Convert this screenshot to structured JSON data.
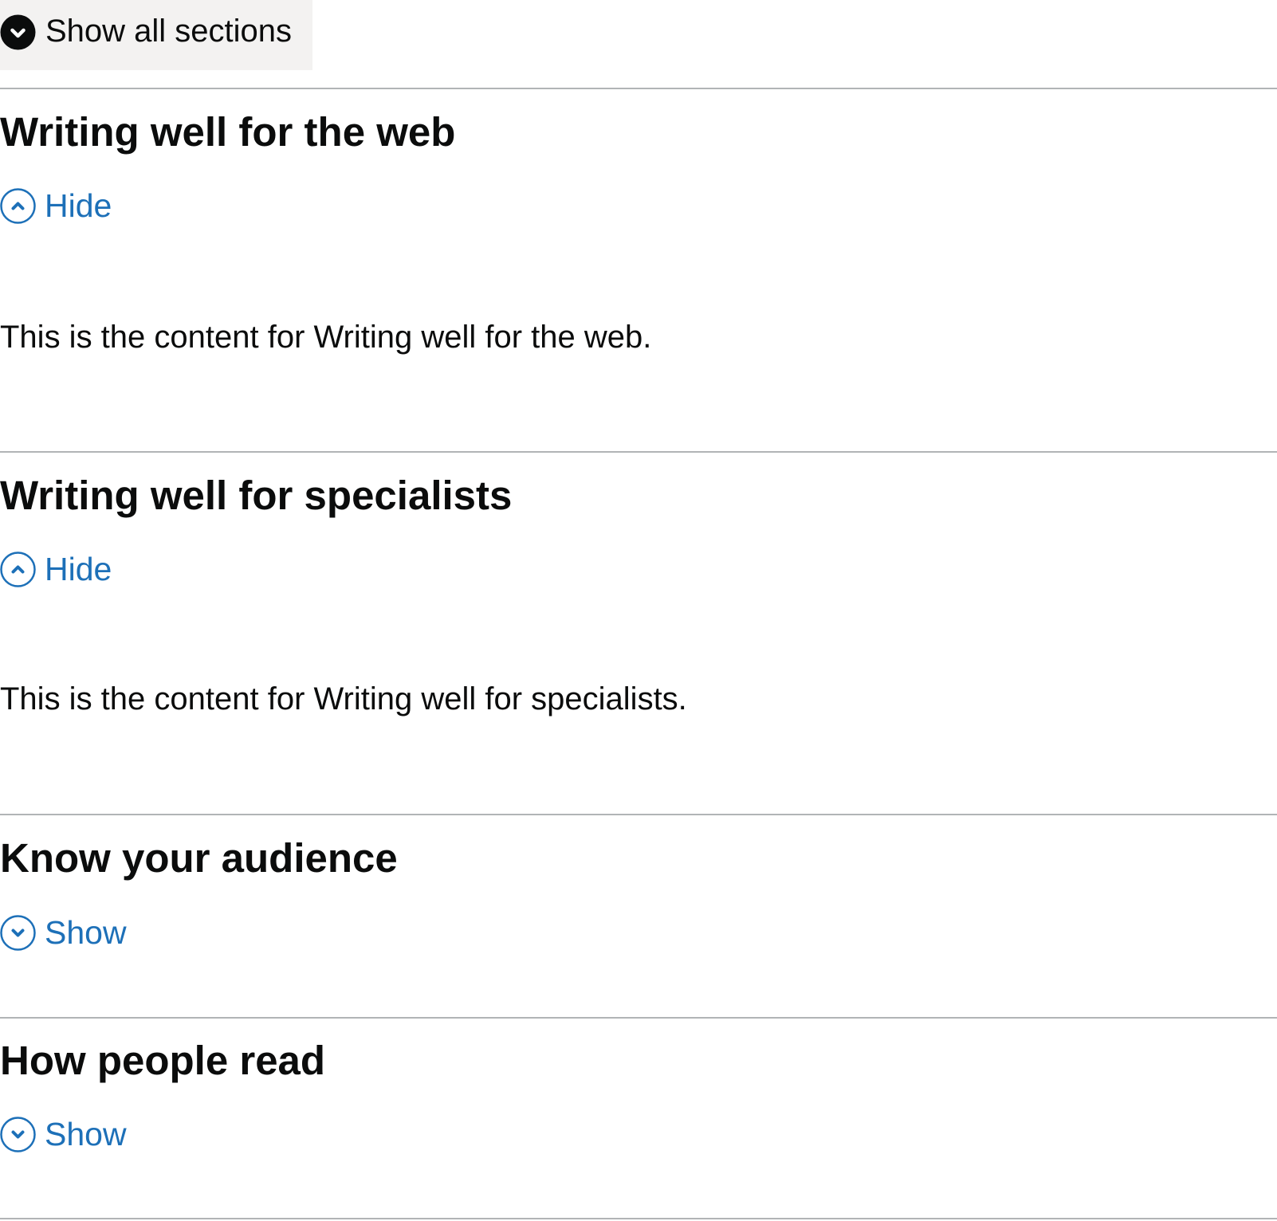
{
  "accordion": {
    "show_all_label": "Show all sections",
    "show_all_icon": "chevron-down-circle-filled-icon",
    "sections": [
      {
        "heading": "Writing well for the web",
        "toggle_label": "Hide",
        "toggle_icon": "chevron-up-circle-icon",
        "expanded": true,
        "content": "This is the content for Writing well for the web."
      },
      {
        "heading": "Writing well for specialists",
        "toggle_label": "Hide",
        "toggle_icon": "chevron-up-circle-icon",
        "expanded": true,
        "content": "This is the content for Writing well for specialists."
      },
      {
        "heading": "Know your audience",
        "toggle_label": "Show",
        "toggle_icon": "chevron-down-circle-icon",
        "expanded": false
      },
      {
        "heading": "How people read",
        "toggle_label": "Show",
        "toggle_icon": "chevron-down-circle-icon",
        "expanded": false
      }
    ]
  },
  "colors": {
    "text": "#0b0c0c",
    "link": "#1d70b8",
    "divider": "#b1b4b6",
    "show_all_background": "#f3f2f1"
  }
}
